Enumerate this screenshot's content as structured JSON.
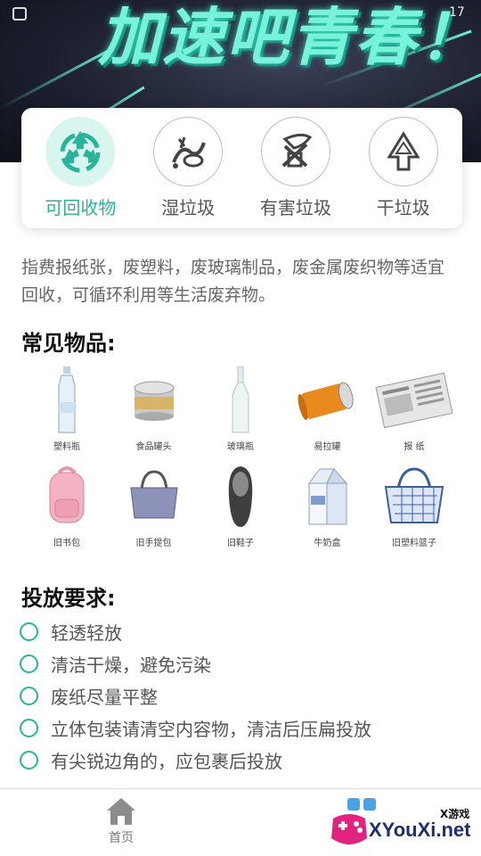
{
  "banner": {
    "title": "加速吧青春！"
  },
  "status_bar": {
    "time": "17"
  },
  "categories": [
    {
      "label": "可回收物",
      "icon": "recycle-icon",
      "active": true
    },
    {
      "label": "湿垃圾",
      "icon": "wet-garbage-icon",
      "active": false
    },
    {
      "label": "有害垃圾",
      "icon": "hazardous-icon",
      "active": false
    },
    {
      "label": "干垃圾",
      "icon": "dry-garbage-icon",
      "active": false
    }
  ],
  "description": "指费报纸张，废塑料，废玻璃制品，废金属废织物等适宜回收，可循环利用等生活废弃物。",
  "common_items": {
    "heading": "常见物品:",
    "rows": [
      [
        {
          "label": "塑料瓶",
          "icon": "plastic-bottle-icon"
        },
        {
          "label": "食品罐头",
          "icon": "food-can-icon"
        },
        {
          "label": "玻璃瓶",
          "icon": "glass-bottle-icon"
        },
        {
          "label": "易拉罐",
          "icon": "soda-can-icon"
        },
        {
          "label": "报 纸",
          "icon": "newspaper-icon"
        }
      ],
      [
        {
          "label": "旧书包",
          "icon": "backpack-icon"
        },
        {
          "label": "旧手提包",
          "icon": "handbag-icon"
        },
        {
          "label": "旧鞋子",
          "icon": "shoe-icon"
        },
        {
          "label": "牛奶盒",
          "icon": "milk-carton-icon"
        },
        {
          "label": "旧塑料篮子",
          "icon": "plastic-basket-icon"
        }
      ]
    ]
  },
  "requirements": {
    "heading": "投放要求:",
    "items": [
      "轻透轻放",
      "清洁干燥，避免污染",
      "废纸尽量平整",
      "立体包装请清空内容物，清洁后压扁投放",
      "有尖锐边角的，应包裹后投放"
    ]
  },
  "tabbar": {
    "home_label": "首页"
  },
  "watermark": {
    "main": "XYouXi.net",
    "sub": "X游戏"
  },
  "colors": {
    "accent": "#2bb39a",
    "accent_bg": "#d8f5ef"
  }
}
